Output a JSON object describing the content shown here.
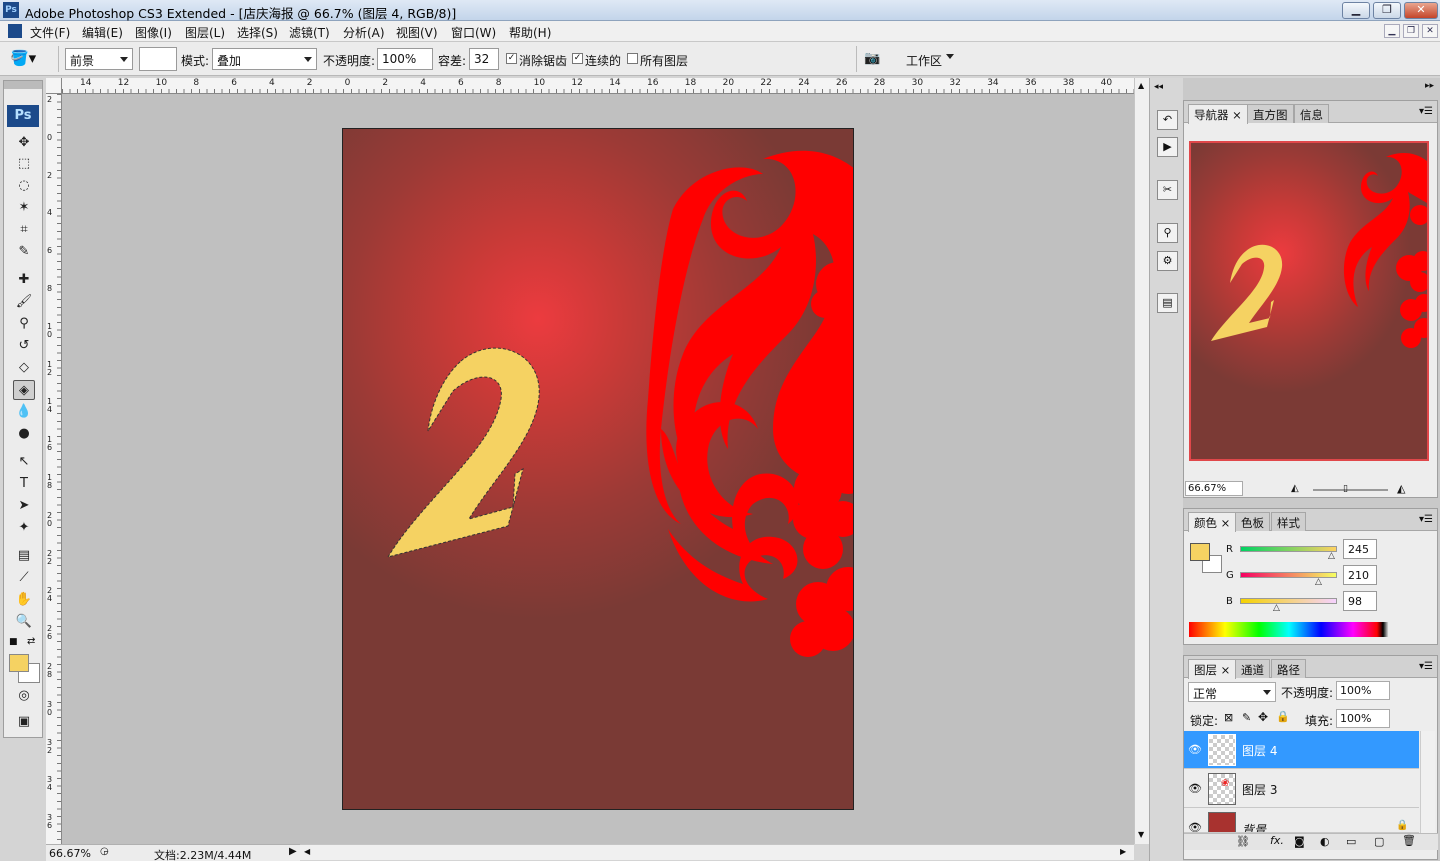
{
  "window": {
    "title": "Adobe Photoshop CS3 Extended - [店庆海报 @ 66.7% (图层 4, RGB/8)]",
    "logo": "Ps"
  },
  "menu": [
    "文件(F)",
    "编辑(E)",
    "图像(I)",
    "图层(L)",
    "选择(S)",
    "滤镜(T)",
    "分析(A)",
    "视图(V)",
    "窗口(W)",
    "帮助(H)"
  ],
  "options": {
    "fill_source": "前景",
    "mode_label": "模式:",
    "mode_value": "叠加",
    "opacity_label": "不透明度:",
    "opacity_value": "100%",
    "tolerance_label": "容差:",
    "tolerance_value": "32",
    "antialias_label": "消除锯齿",
    "contiguous_label": "连续的",
    "all_layers_label": "所有图层",
    "workspace_label": "工作区"
  },
  "ruler": {
    "top_labels": [
      "14",
      "12",
      "10",
      "8",
      "6",
      "4",
      "2",
      "0",
      "2",
      "4",
      "6",
      "8",
      "10",
      "12",
      "14",
      "16",
      "18",
      "20",
      "22",
      "24",
      "26",
      "28",
      "30",
      "32",
      "34",
      "36",
      "38",
      "40"
    ],
    "left_labels": [
      "2",
      "0",
      "2",
      "4",
      "6",
      "8",
      "1\n0",
      "1\n2",
      "1\n4",
      "1\n6",
      "1\n8",
      "2\n0",
      "2\n2",
      "2\n4",
      "2\n6",
      "2\n8",
      "3\n0",
      "3\n2",
      "3\n4",
      "3\n6"
    ]
  },
  "canvas": {
    "number_glyph": "2"
  },
  "status": {
    "zoom": "66.67%",
    "doc_info": "文档:2.23M/4.44M"
  },
  "panels": {
    "navigator": {
      "tabs": [
        "导航器",
        "直方图",
        "信息"
      ],
      "zoom": "66.67%"
    },
    "color": {
      "tabs": [
        "颜色",
        "色板",
        "样式"
      ],
      "r_label": "R",
      "g_label": "G",
      "b_label": "B",
      "r": "245",
      "g": "210",
      "b": "98",
      "fg_color": "#f5d262"
    },
    "layers": {
      "tabs": [
        "图层",
        "通道",
        "路径"
      ],
      "blend_mode": "正常",
      "opacity_label": "不透明度:",
      "opacity_value": "100%",
      "lock_label": "锁定:",
      "fill_label": "填充:",
      "fill_value": "100%",
      "items": [
        {
          "name": "图层 4",
          "selected": true
        },
        {
          "name": "图层 3",
          "selected": false
        },
        {
          "name": "背景",
          "selected": false
        }
      ]
    }
  }
}
